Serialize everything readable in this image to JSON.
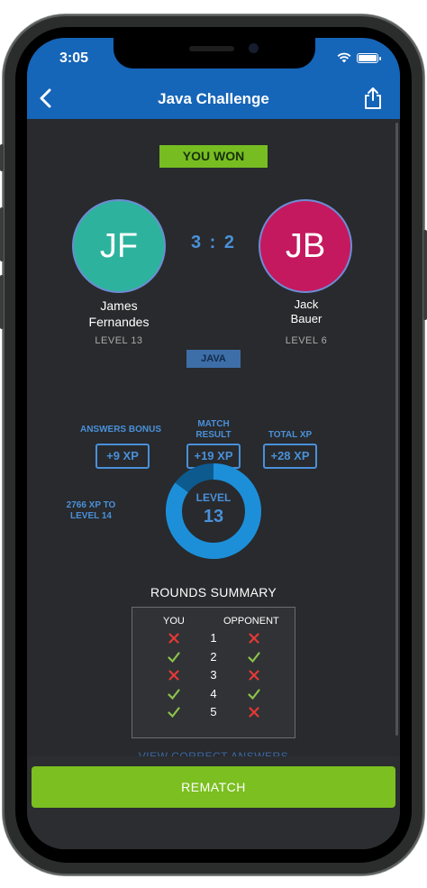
{
  "status": {
    "time": "3:05"
  },
  "nav": {
    "title": "Java Challenge"
  },
  "result": {
    "label": "YOU WON",
    "score": "3 : 2",
    "language": "JAVA"
  },
  "players": {
    "left": {
      "initials": "JF",
      "name_line1": "James",
      "name_line2": "Fernandes",
      "level": "LEVEL 13",
      "color": "#2db39d"
    },
    "right": {
      "initials": "JB",
      "name_line1": "Jack",
      "name_line2": "Bauer",
      "level": "LEVEL 6",
      "color": "#c4195f"
    }
  },
  "xp": {
    "answers_bonus": {
      "label": "ANSWERS BONUS",
      "value": "+9 XP"
    },
    "match_result": {
      "label_line1": "MATCH",
      "label_line2": "RESULT",
      "value": "+19 XP"
    },
    "total": {
      "label": "TOTAL XP",
      "value": "+28 XP"
    }
  },
  "level": {
    "label": "LEVEL",
    "number": "13",
    "xp_to_line1": "2766 XP TO",
    "xp_to_line2": "LEVEL 14",
    "progress_fraction": 0.85
  },
  "rounds": {
    "title": "ROUNDS SUMMARY",
    "col_you": "YOU",
    "col_opponent": "OPPONENT",
    "rows": [
      {
        "num": "1",
        "you": "wrong",
        "opponent": "wrong"
      },
      {
        "num": "2",
        "you": "correct",
        "opponent": "correct"
      },
      {
        "num": "3",
        "you": "wrong",
        "opponent": "wrong"
      },
      {
        "num": "4",
        "you": "correct",
        "opponent": "correct"
      },
      {
        "num": "5",
        "you": "correct",
        "opponent": "wrong"
      }
    ]
  },
  "links": {
    "view_answers": "VIEW CORRECT ANSWERS"
  },
  "actions": {
    "rematch": "REMATCH"
  },
  "colors": {
    "accent": "#1565b8",
    "win": "#77bd22",
    "blue_text": "#4a90d9",
    "correct": "#8bc34a",
    "wrong": "#e53935"
  }
}
